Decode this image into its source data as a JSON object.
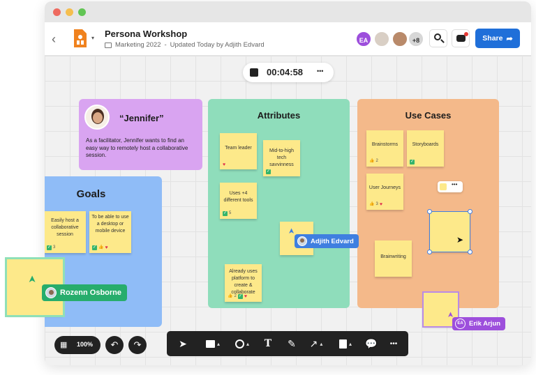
{
  "app": {
    "doc_title": "Persona Workshop",
    "folder": "Marketing 2022",
    "updated": "Updated Today by Adjith Edvard",
    "separator": "-",
    "collab_initials": "EA",
    "collab_more": "+8",
    "share_label": "Share"
  },
  "timer": {
    "value": "00:04:58",
    "more": "•••"
  },
  "persona": {
    "name": "“Jennifer”",
    "description": "As a facilitator, Jennifer wants to find an easy way to remotely host a collaborative session."
  },
  "frames": {
    "goals": {
      "title": "Goals",
      "notes": [
        {
          "text": "Easily host a collaborative session",
          "count": "3"
        },
        {
          "text": "To be able to use a desktop or mobile device"
        }
      ]
    },
    "attributes": {
      "title": "Attributes",
      "notes": [
        {
          "text": "Team leader"
        },
        {
          "text": "Mid-to-high tech savvinness"
        },
        {
          "text": "Uses +4 different tools",
          "count": "5"
        },
        {
          "text": "Already uses platform to create & collaborate",
          "count": "2"
        }
      ]
    },
    "use_cases": {
      "title": "Use Cases",
      "notes": [
        {
          "text": "Brainstorms",
          "count": "2"
        },
        {
          "text": "Storyboards"
        },
        {
          "text": "User Journeys",
          "count": "3"
        },
        {
          "text": "Brainwriting"
        }
      ]
    }
  },
  "cursors": {
    "adjith": {
      "name": "Adjith Edvard",
      "color": "#3f7fe0"
    },
    "rozenn": {
      "name": "Rozenn Osborne",
      "color": "#27ad6c"
    },
    "erik": {
      "name": "Erik Arjun",
      "initials": "EA",
      "color": "#9d4fdc"
    }
  },
  "toolbar": {
    "zoom": "100%",
    "more": "•••"
  },
  "colors": {
    "persona": "#d9a4f1",
    "goals": "#8fbcf7",
    "attributes": "#8fddbb",
    "use_cases": "#f4b98a",
    "note": "#fde98a",
    "share": "#1f6fd9"
  }
}
